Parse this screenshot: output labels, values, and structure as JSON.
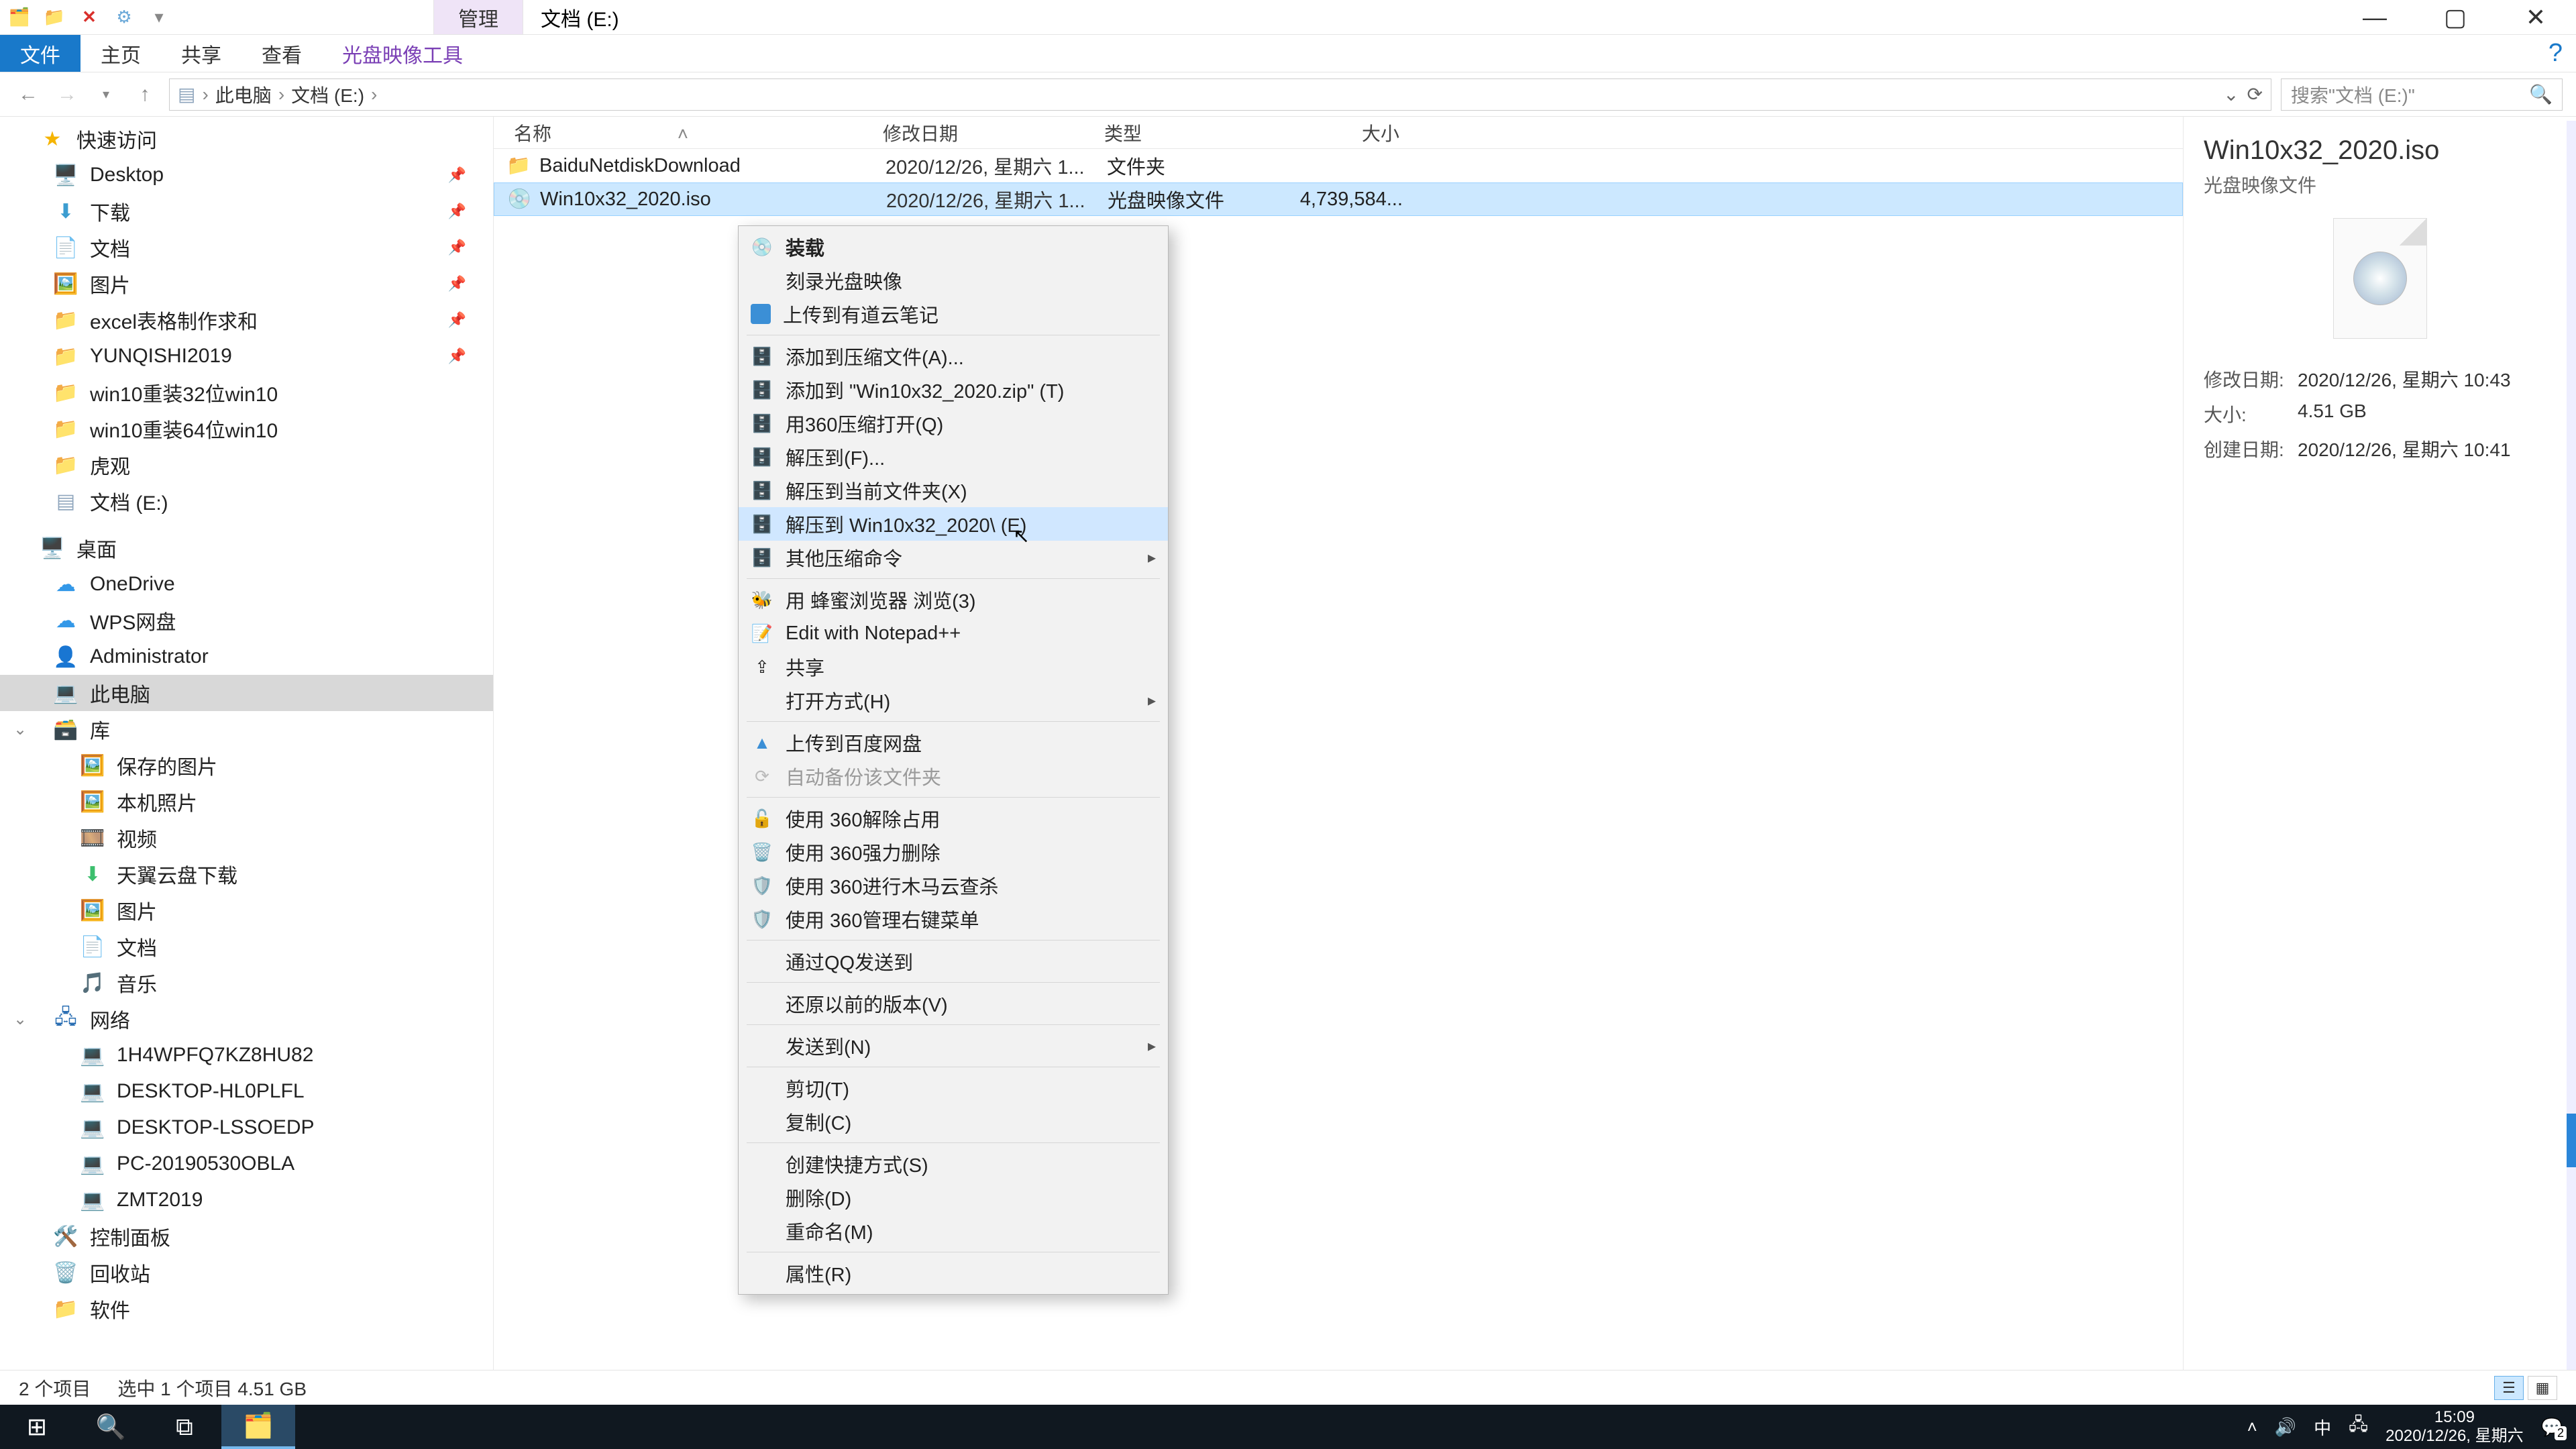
{
  "titlebar": {
    "manage_tab": "管理",
    "location_tab": "文档 (E:)"
  },
  "ribbon": {
    "file": "文件",
    "home": "主页",
    "share": "共享",
    "view": "查看",
    "tool": "光盘映像工具"
  },
  "address": {
    "root": "此电脑",
    "drive": "文档 (E:)"
  },
  "search": {
    "placeholder": "搜索\"文档 (E:)\""
  },
  "sidebar": {
    "quick": "快速访问",
    "items": [
      {
        "label": "Desktop"
      },
      {
        "label": "下载"
      },
      {
        "label": "文档"
      },
      {
        "label": "图片"
      },
      {
        "label": "excel表格制作求和"
      },
      {
        "label": "YUNQISHI2019"
      },
      {
        "label": "win10重装32位win10"
      },
      {
        "label": "win10重装64位win10"
      },
      {
        "label": "虎观"
      },
      {
        "label": "文档 (E:)"
      }
    ],
    "desktop": "桌面",
    "onedrive": "OneDrive",
    "wps": "WPS网盘",
    "admin": "Administrator",
    "thispc": "此电脑",
    "library": "库",
    "lib_items": [
      {
        "label": "保存的图片"
      },
      {
        "label": "本机照片"
      },
      {
        "label": "视频"
      },
      {
        "label": "天翼云盘下载"
      },
      {
        "label": "图片"
      },
      {
        "label": "文档"
      },
      {
        "label": "音乐"
      }
    ],
    "network": "网络",
    "net_items": [
      {
        "label": "1H4WPFQ7KZ8HU82"
      },
      {
        "label": "DESKTOP-HL0PLFL"
      },
      {
        "label": "DESKTOP-LSSOEDP"
      },
      {
        "label": "PC-20190530OBLA"
      },
      {
        "label": "ZMT2019"
      }
    ],
    "ctrlpanel": "控制面板",
    "recycle": "回收站",
    "software": "软件"
  },
  "columns": {
    "name": "名称",
    "date": "修改日期",
    "type": "类型",
    "size": "大小"
  },
  "rows": [
    {
      "name": "BaiduNetdiskDownload",
      "date": "2020/12/26, 星期六 1...",
      "type": "文件夹",
      "size": ""
    },
    {
      "name": "Win10x32_2020.iso",
      "date": "2020/12/26, 星期六 1...",
      "type": "光盘映像文件",
      "size": "4,739,584..."
    }
  ],
  "details": {
    "title": "Win10x32_2020.iso",
    "sub": "光盘映像文件",
    "modlabel": "修改日期:",
    "mod": "2020/12/26, 星期六 10:43",
    "sizelabel": "大小:",
    "size": "4.51 GB",
    "createlabel": "创建日期:",
    "create": "2020/12/26, 星期六 10:41"
  },
  "context": {
    "mount": "装载",
    "burn": "刻录光盘映像",
    "youdao": "上传到有道云笔记",
    "add_archive": "添加到压缩文件(A)...",
    "add_zip": "添加到 \"Win10x32_2020.zip\" (T)",
    "open_360": "用360压缩打开(Q)",
    "extract_f": "解压到(F)...",
    "extract_here": "解压到当前文件夹(X)",
    "extract_named": "解压到 Win10x32_2020\\ (E)",
    "other_zip": "其他压缩命令",
    "bee_browser": "用 蜂蜜浏览器 浏览(3)",
    "notepadpp": "Edit with Notepad++",
    "share": "共享",
    "open_with": "打开方式(H)",
    "upload_baidu": "上传到百度网盘",
    "auto_backup": "自动备份该文件夹",
    "unlock360": "使用 360解除占用",
    "forcedel360": "使用 360强力删除",
    "trojan360": "使用 360进行木马云查杀",
    "menu360": "使用 360管理右键菜单",
    "qq_send": "通过QQ发送到",
    "restore": "还原以前的版本(V)",
    "sendto": "发送到(N)",
    "cut": "剪切(T)",
    "copy": "复制(C)",
    "shortcut": "创建快捷方式(S)",
    "delete": "删除(D)",
    "rename": "重命名(M)",
    "properties": "属性(R)"
  },
  "status": {
    "count": "2 个项目",
    "selection": "选中 1 个项目  4.51 GB"
  },
  "tray": {
    "ime": "中",
    "time": "15:09",
    "date": "2020/12/26, 星期六",
    "notif": "2"
  }
}
